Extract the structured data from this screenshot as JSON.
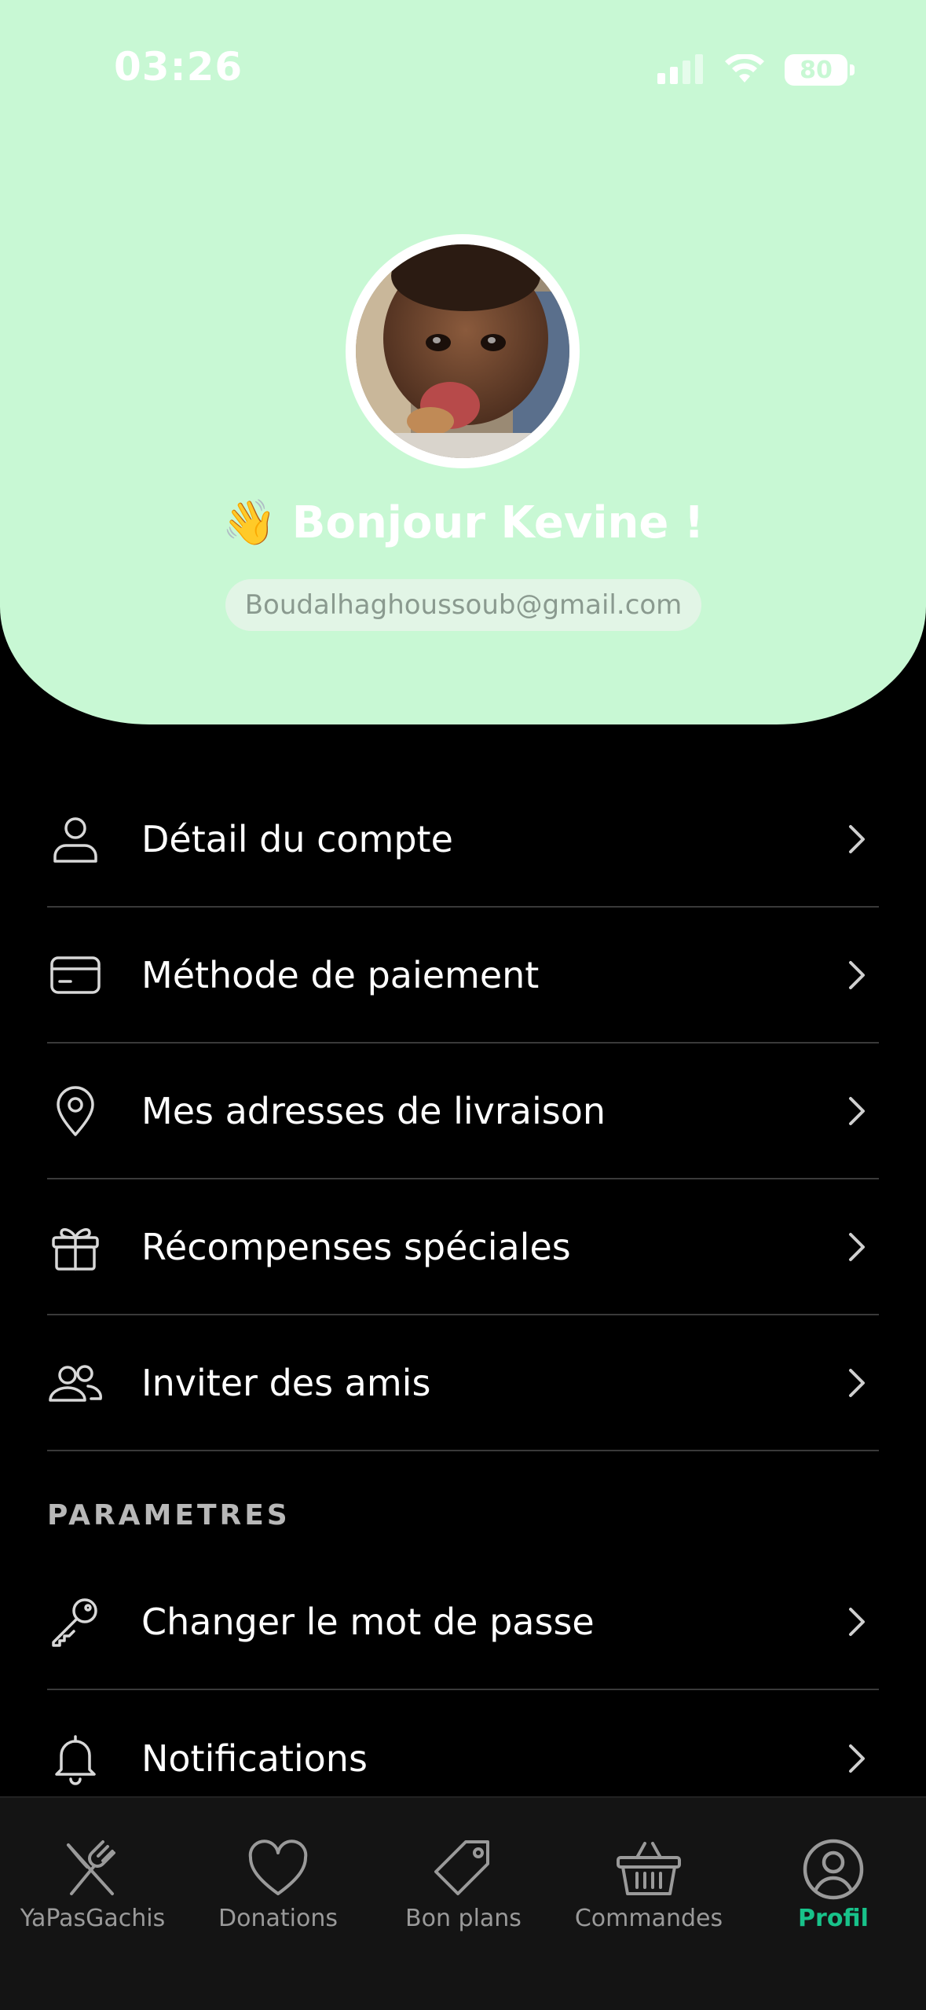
{
  "status_bar": {
    "time": "03:26",
    "battery": "80"
  },
  "profile": {
    "greeting_emoji": "👋",
    "greeting": "Bonjour Kevine !",
    "email": "Boudalhaghoussoub@gmail.com"
  },
  "menu": {
    "items": [
      {
        "label": "Détail du compte",
        "icon": "user-icon"
      },
      {
        "label": "Méthode de paiement",
        "icon": "credit-card-icon"
      },
      {
        "label": "Mes adresses de livraison",
        "icon": "map-pin-icon"
      },
      {
        "label": "Récompenses spéciales",
        "icon": "gift-icon"
      },
      {
        "label": "Inviter des amis",
        "icon": "users-icon"
      }
    ]
  },
  "settings": {
    "title": "PARAMETRES",
    "items": [
      {
        "label": "Changer le mot de passe",
        "icon": "key-icon"
      },
      {
        "label": "Notifications",
        "icon": "bell-icon"
      }
    ]
  },
  "tabbar": {
    "tabs": [
      {
        "label": "YaPasGachis",
        "icon": "utensils-icon"
      },
      {
        "label": "Donations",
        "icon": "heart-icon"
      },
      {
        "label": "Bon plans",
        "icon": "tag-icon"
      },
      {
        "label": "Commandes",
        "icon": "basket-icon"
      },
      {
        "label": "Profil",
        "icon": "user-circle-icon",
        "active": true
      }
    ]
  },
  "colors": {
    "header_bg": "#c8f8d4",
    "accent": "#18c28a",
    "background": "#000000"
  }
}
